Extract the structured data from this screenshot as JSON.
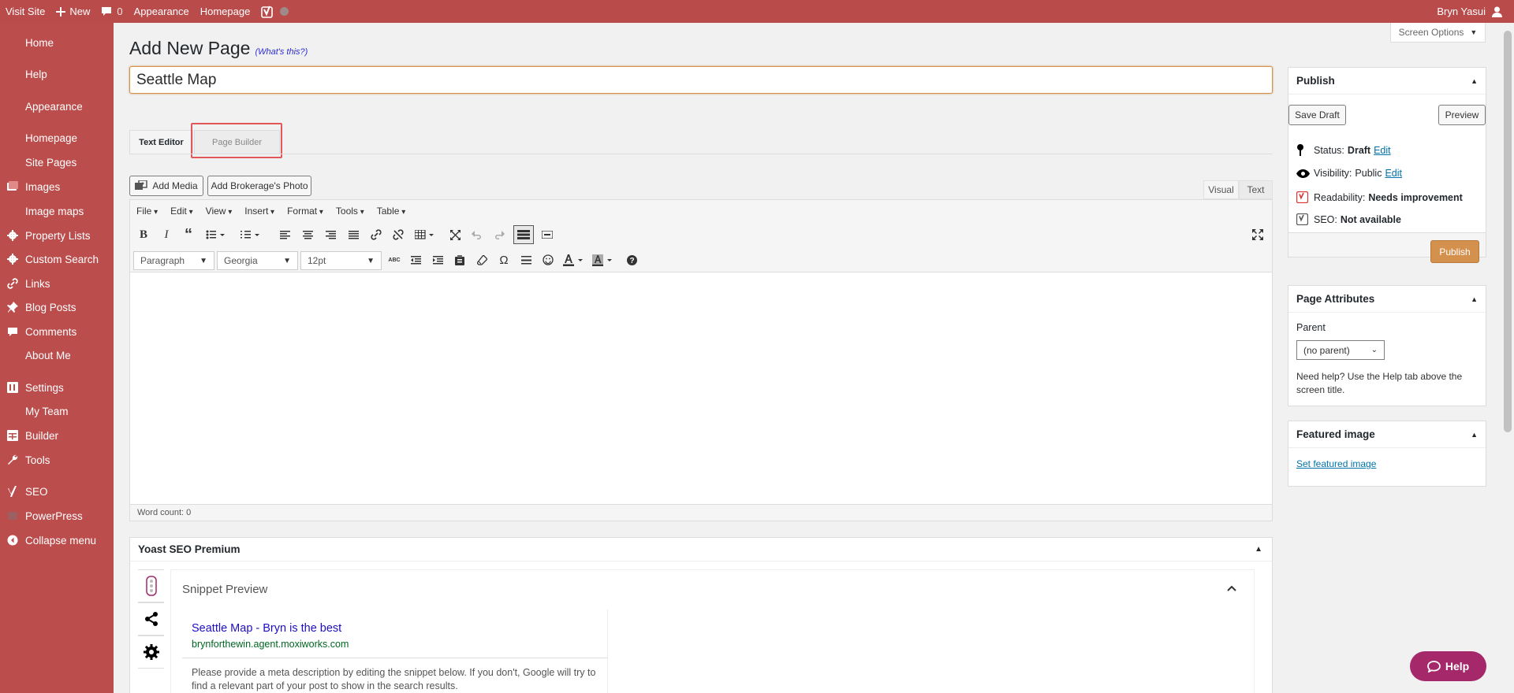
{
  "admin_bar": {
    "visit_site": "Visit Site",
    "new": "New",
    "comments_count": "0",
    "appearance": "Appearance",
    "homepage": "Homepage",
    "user": "Bryn Yasui"
  },
  "sidebar": {
    "items": [
      {
        "label": "Home",
        "icon": "none"
      },
      {
        "label": "Help",
        "icon": "none"
      },
      {
        "label": "Appearance",
        "icon": "none"
      },
      {
        "label": "Homepage",
        "icon": "none"
      },
      {
        "label": "Site Pages",
        "icon": "none"
      },
      {
        "label": "Images",
        "icon": "images-icon"
      },
      {
        "label": "Image maps",
        "icon": "none"
      },
      {
        "label": "Property Lists",
        "icon": "gear-icon"
      },
      {
        "label": "Custom Search",
        "icon": "gear-icon"
      },
      {
        "label": "Links",
        "icon": "link-icon"
      },
      {
        "label": "Blog Posts",
        "icon": "pin-icon"
      },
      {
        "label": "Comments",
        "icon": "comment-icon"
      },
      {
        "label": "About Me",
        "icon": "none"
      },
      {
        "label": "Settings",
        "icon": "settings-icon"
      },
      {
        "label": "My Team",
        "icon": "none"
      },
      {
        "label": "Builder",
        "icon": "builder-icon"
      },
      {
        "label": "Tools",
        "icon": "wrench-icon"
      },
      {
        "label": "SEO",
        "icon": "yoast-icon"
      },
      {
        "label": "PowerPress",
        "icon": "powerpress-icon"
      },
      {
        "label": "Collapse menu",
        "icon": "collapse-icon"
      }
    ]
  },
  "screen_options": "Screen Options",
  "header": {
    "title": "Add New Page",
    "whats_this": "(What's this?)"
  },
  "title_input": {
    "value": "Seattle Map"
  },
  "editor_tabs": {
    "text_editor": "Text Editor",
    "page_builder": "Page Builder"
  },
  "media_buttons": {
    "add_media": "Add Media",
    "add_brokerage_photo": "Add Brokerage's Photo"
  },
  "view_tabs": {
    "visual": "Visual",
    "text": "Text"
  },
  "menubar": [
    "File",
    "Edit",
    "View",
    "Insert",
    "Format",
    "Tools",
    "Table"
  ],
  "format_selects": {
    "paragraph": "Paragraph",
    "font": "Georgia",
    "size": "12pt"
  },
  "statusbar": {
    "word_count": "Word count: 0"
  },
  "yoast": {
    "title": "Yoast SEO Premium",
    "snippet_preview": "Snippet Preview",
    "snippet_title": "Seattle Map - Bryn is the best",
    "snippet_url": "brynforthewin.agent.moxiworks.com",
    "snippet_desc": "Please provide a meta description by editing the snippet below. If you don't, Google will try to find a relevant part of your post to show in the search results."
  },
  "publish": {
    "title": "Publish",
    "save_draft": "Save Draft",
    "preview": "Preview",
    "status_label": "Status:",
    "status_value": "Draft",
    "visibility_label": "Visibility:",
    "visibility_value": "Public",
    "readability_label": "Readability:",
    "readability_value": "Needs improvement",
    "seo_label": "SEO:",
    "seo_value": "Not available",
    "edit": "Edit",
    "publish_button": "Publish"
  },
  "page_attributes": {
    "title": "Page Attributes",
    "parent_label": "Parent",
    "parent_value": "(no parent)",
    "help_text": "Need help? Use the Help tab above the screen title."
  },
  "featured_image": {
    "title": "Featured image",
    "link": "Set featured image"
  },
  "help_button": "Help",
  "colors": {
    "admin_bar": "#b94b4b",
    "sidebar": "#bb4d4d",
    "publish_button": "#d4914e",
    "help_button": "#a4286a",
    "link": "#0073aa"
  }
}
